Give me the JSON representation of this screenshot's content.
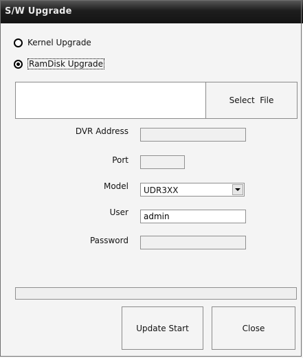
{
  "window": {
    "title": "S/W Upgrade"
  },
  "upgrade_type": {
    "options": [
      {
        "label": "Kernel Upgrade",
        "selected": false
      },
      {
        "label": "RamDisk Upgrade",
        "selected": true
      }
    ]
  },
  "file": {
    "path": "",
    "select_label": "Select  File"
  },
  "form": {
    "dvr_address": {
      "label": "DVR Address",
      "value": ""
    },
    "port": {
      "label": "Port",
      "value": ""
    },
    "model": {
      "label": "Model",
      "value": "UDR3XX"
    },
    "user": {
      "label": "User",
      "value": "admin"
    },
    "password": {
      "label": "Password",
      "value": ""
    }
  },
  "progress": {
    "fraction": 0.0
  },
  "buttons": {
    "update_start": "Update Start",
    "close": "Close"
  },
  "colors": {
    "titlebar": "#1e1e1e",
    "window_bg": "#f4f4f4",
    "progress_fill": "#3c78d8"
  },
  "icons": {
    "model_dropdown": "chevron-down-icon"
  }
}
